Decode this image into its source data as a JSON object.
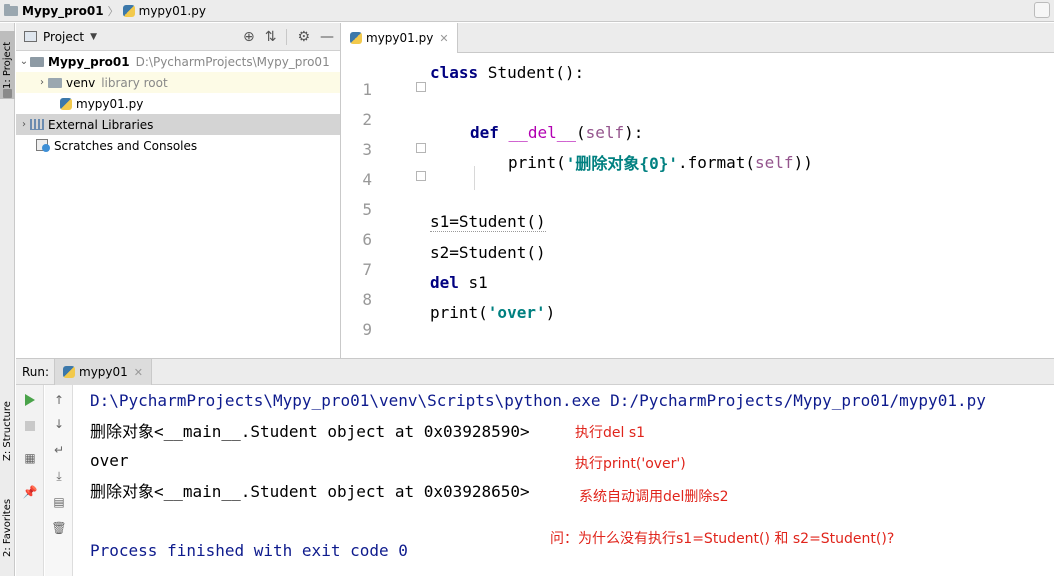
{
  "navbar": {
    "project": "Mypy_pro01",
    "file": "mypy01.py"
  },
  "left_stripe": {
    "project_tab": "1: Project",
    "structure_tab": "Z: Structure",
    "favorites_tab": "2: Favorites"
  },
  "project_panel": {
    "title": "Project",
    "tree": {
      "root_name": "Mypy_pro01",
      "root_path": "D:\\PycharmProjects\\Mypy_pro01",
      "venv": "venv",
      "venv_note": "library root",
      "file": "mypy01.py",
      "external_libraries": "External Libraries",
      "scratches": "Scratches and Consoles"
    }
  },
  "editor": {
    "tab_label": "mypy01.py",
    "line_numbers": [
      "1",
      "2",
      "3",
      "4",
      "5",
      "6",
      "7",
      "8",
      "9"
    ],
    "code": {
      "l1_kw": "class",
      "l1_rest": " Student():",
      "l3_kw": "def",
      "l3_name": "__del__",
      "l3_open": "(",
      "l3_self": "self",
      "l3_close": "):",
      "l4_fn": "print(",
      "l4_str": "'删除对象{0}'",
      "l4_fmt": ".format(",
      "l4_self": "self",
      "l4_close": "))",
      "l6": "s1=Student()",
      "l7": "s2=Student()",
      "l8_kw": "del",
      "l8_rest": " s1",
      "l9_fn": "print(",
      "l9_str": "'over'",
      "l9_close": ")"
    }
  },
  "run_panel": {
    "label": "Run:",
    "tab": "mypy01",
    "console": {
      "cmd": "D:\\PycharmProjects\\Mypy_pro01\\venv\\Scripts\\python.exe D:/PycharmProjects/Mypy_pro01/mypy01.py",
      "out1": "删除对象<__main__.Student object at 0x03928590>",
      "out2": "over",
      "out3": "删除对象<__main__.Student object at 0x03928650>",
      "finish": "Process finished with exit code 0"
    },
    "annotations": {
      "a1": "执行del s1",
      "a2": "执行print('over')",
      "a3": "系统自动调用del删除s2",
      "a4": "问：为什么没有执行s1=Student() 和 s2=Student()?"
    }
  },
  "colors": {
    "keyword": "#000080",
    "string": "#008080",
    "magic": "#b200b2",
    "annotation": "#e0241b",
    "console_path": "#0e1b8d"
  }
}
